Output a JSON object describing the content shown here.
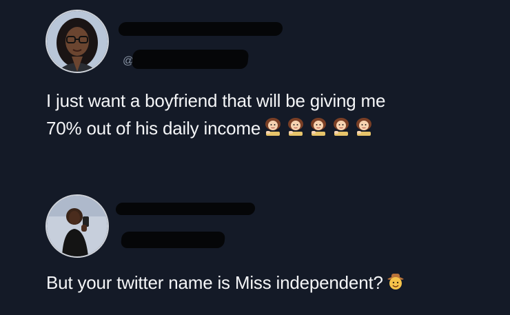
{
  "tweets": [
    {
      "avatar_icon": "profile-photo-woman-glasses",
      "handle_prefix": "@",
      "text_line1": "I just want a boyfriend that will be giving me",
      "text_line2": "70% out of his daily income",
      "emoji_icon": "woman-tipping-hand",
      "emoji_count": 5
    },
    {
      "avatar_icon": "profile-photo-woman-selfie",
      "text_line1": "But your twitter name is Miss independent?",
      "emoji_icon": "cowboy-face"
    }
  ],
  "colors": {
    "background": "#141a27",
    "text": "#f4f5f7",
    "redaction": "#050608"
  }
}
